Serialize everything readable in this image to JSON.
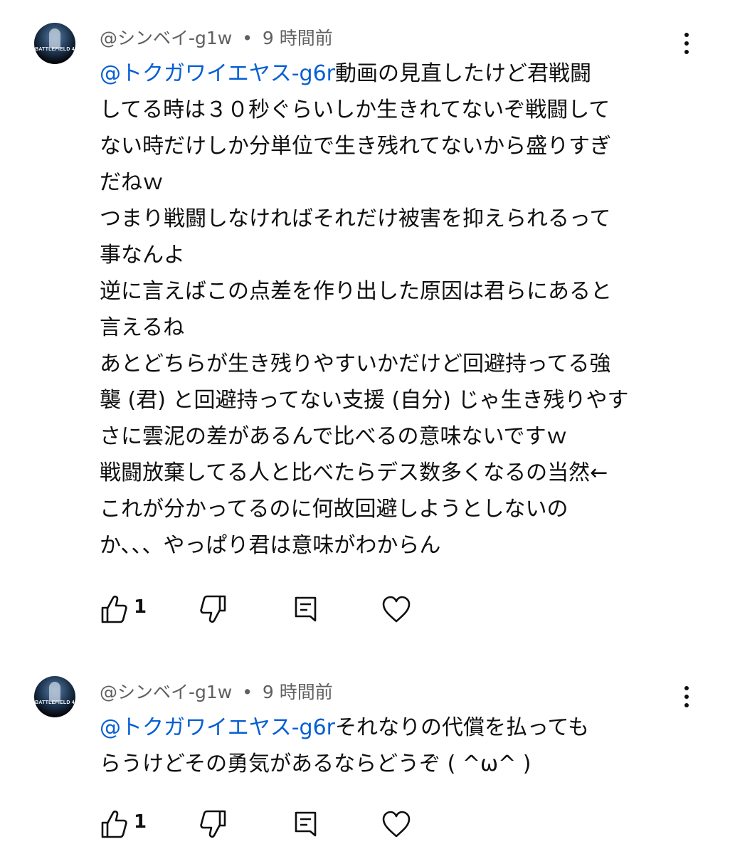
{
  "comments": [
    {
      "author": "@シンベイ-g1w",
      "separator": "•",
      "time": "9 時間前",
      "avatar_text": "BATTLEFIELD 4",
      "mention": "@トクガワイエヤス-g6r",
      "lines": [
        "動画の見直したけど君戦闘",
        "してる時は３０秒ぐらいしか生きれてないぞ戦闘して",
        "ない時だけしか分単位で生き残れてないから盛りすぎ",
        "だねｗ",
        "つまり戦闘しなければそれだけ被害を抑えられるって",
        "事なんよ",
        "逆に言えばこの点差を作り出した原因は君らにあると",
        "言えるね",
        "あとどちらが生き残りやすいかだけど回避持ってる強",
        "襲 (君) と回避持ってない支援 (自分) じゃ生き残りやす",
        "さに雲泥の差があるんで比べるの意味ないですｗ",
        "戦闘放棄してる人と比べたらデス数多くなるの当然←",
        "これが分かってるのに何故回避しようとしないの",
        "か、、、やっぱり君は意味がわからん"
      ],
      "likes": "1"
    },
    {
      "author": "@シンベイ-g1w",
      "separator": "•",
      "time": "9 時間前",
      "avatar_text": "BATTLEFIELD 4",
      "mention": "@トクガワイエヤス-g6r",
      "lines": [
        "それなりの代償を払っても",
        "らうけどその勇気があるならどうぞ ( ^ω^ )"
      ],
      "likes": "1"
    }
  ],
  "icons": {
    "like": "thumbs-up-icon",
    "dislike": "thumbs-down-icon",
    "reply": "reply-comment-icon",
    "heart": "heart-icon",
    "more": "more-vertical-icon"
  },
  "colors": {
    "mention": "#065fd4",
    "meta": "#606060",
    "text": "#0f0f0f"
  }
}
